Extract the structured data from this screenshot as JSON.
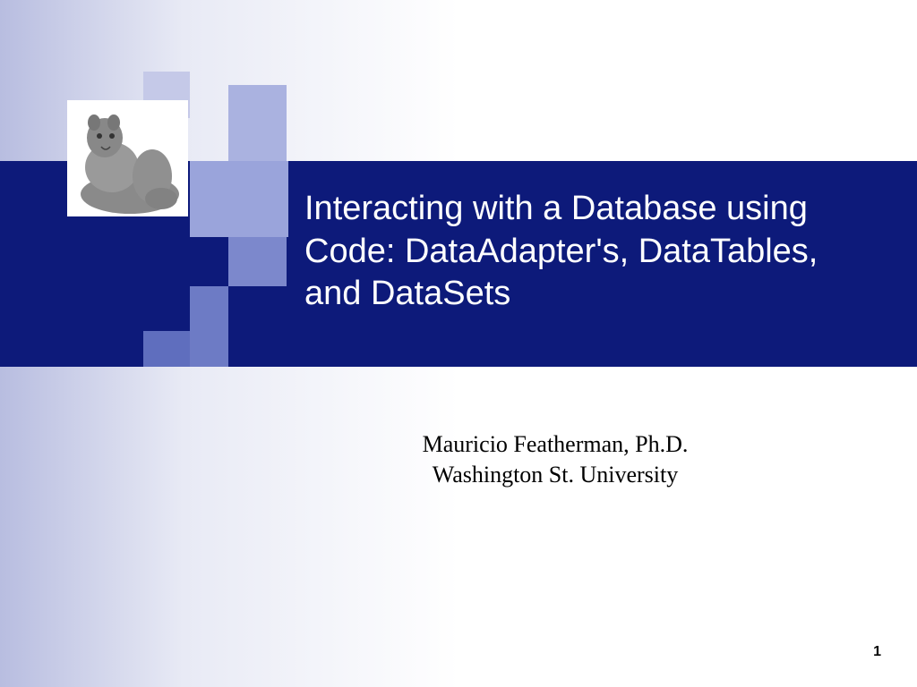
{
  "slide": {
    "title": "Interacting with a Database using Code: DataAdapter's, DataTables, and DataSets",
    "author": "Mauricio Featherman, Ph.D.",
    "affiliation": "Washington St. University",
    "page_number": "1",
    "image_alt": "cougar-mascot"
  },
  "colors": {
    "band": "#0d1a7a",
    "accent1": "#c5c9e8",
    "accent2": "#aab2e0",
    "accent3": "#9aa4db",
    "accent4": "#7c88cc",
    "accent5": "#6d7bc5",
    "accent6": "#5f6ebe"
  }
}
